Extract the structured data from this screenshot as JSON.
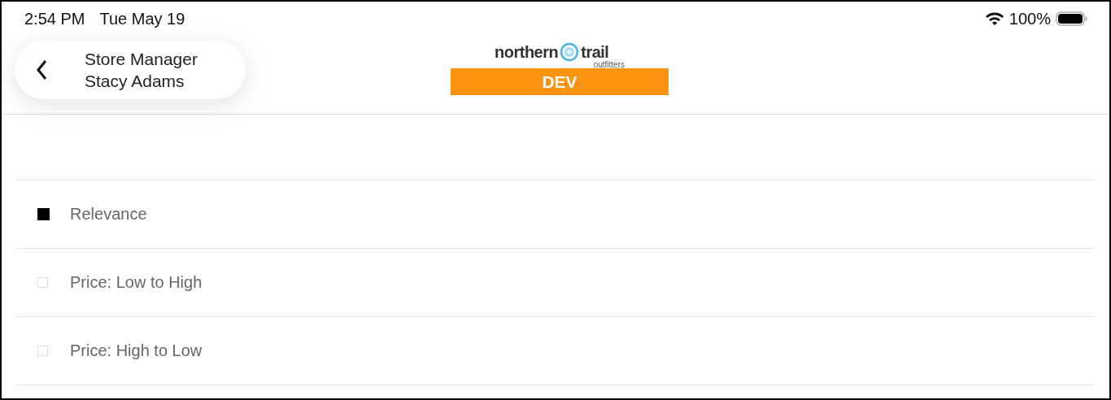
{
  "status_bar": {
    "time": "2:54 PM",
    "date": "Tue May 19",
    "battery": "100%"
  },
  "header": {
    "back_title": "Store Manager",
    "back_subtitle": "Stacy Adams",
    "logo": {
      "word_1": "northern",
      "word_2": "trail",
      "tagline": "outfitters"
    },
    "environment": "DEV"
  },
  "sort_options": [
    {
      "label": "Relevance",
      "selected": true
    },
    {
      "label": "Price: Low to High",
      "selected": false
    },
    {
      "label": "Price: High to Low",
      "selected": false
    }
  ]
}
